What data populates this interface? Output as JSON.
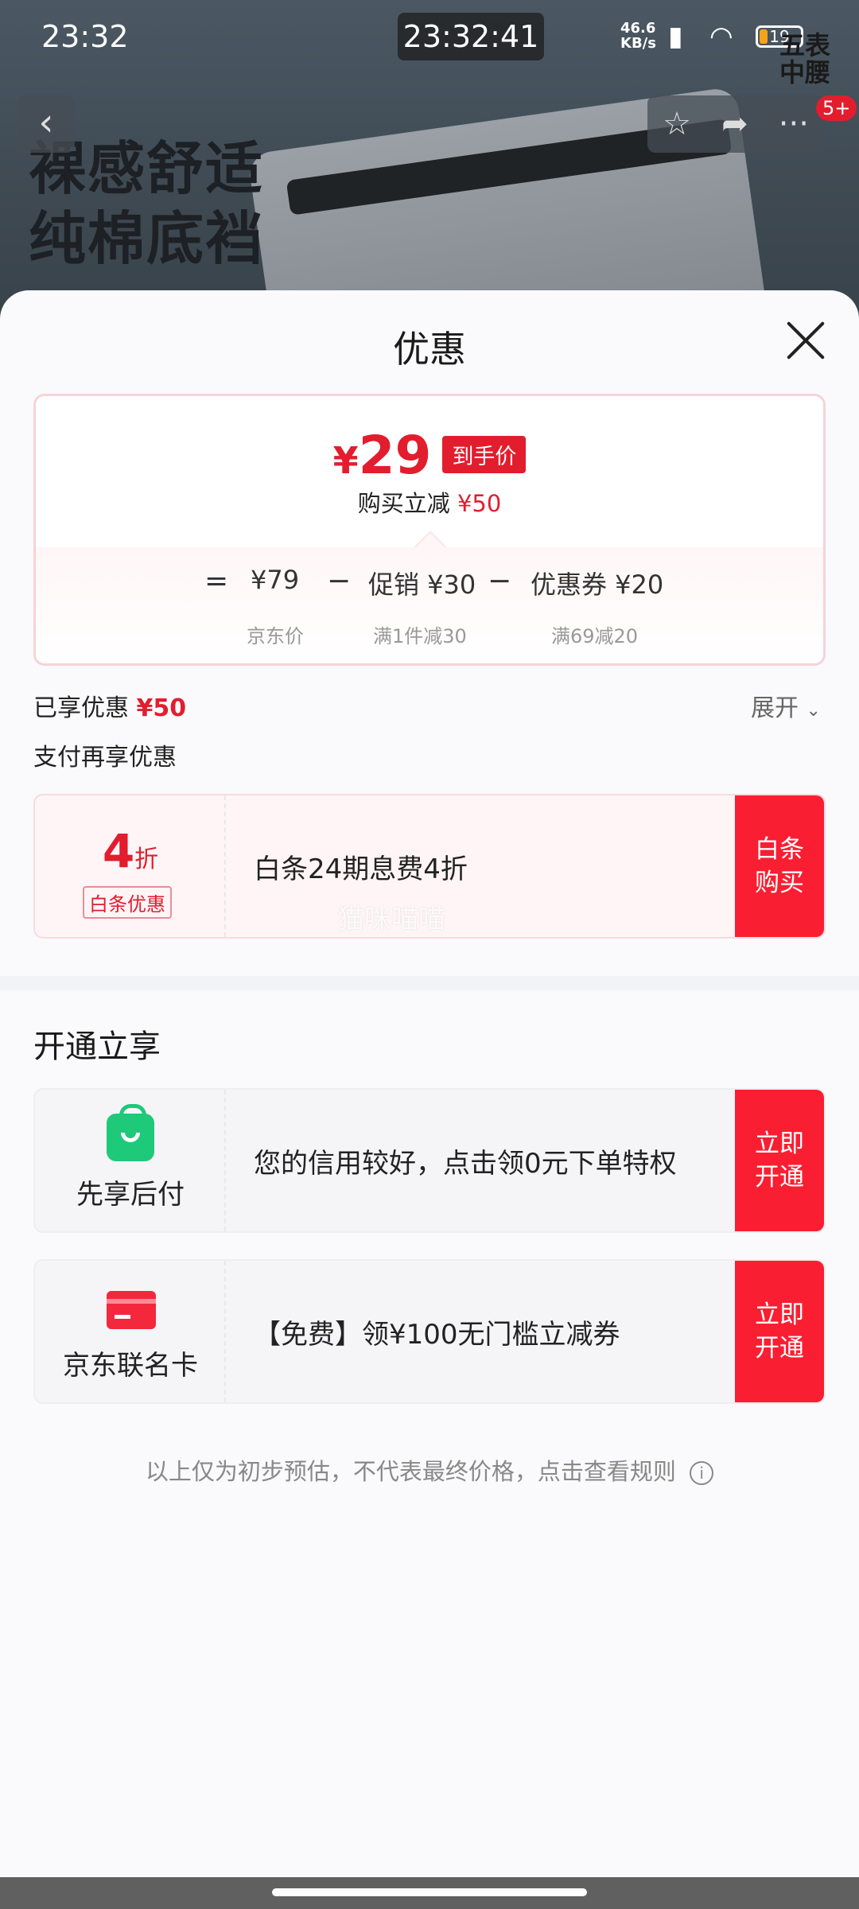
{
  "status_bar": {
    "time": "23:32",
    "clock": "23:32:41",
    "net_speed": "46.6",
    "net_unit": "KB/s",
    "battery": "19",
    "brand_a": "五表",
    "brand_b": "中腰"
  },
  "banner": {
    "slogan_line1": "裸感舒适",
    "slogan_line2": "纯棉底裆",
    "badge": "5+"
  },
  "sheet": {
    "title": "优惠",
    "final_price": {
      "currency": "¥",
      "amount": "29",
      "tag": "到手价"
    },
    "save_text": "购买立减",
    "save_amount": "¥50",
    "breakdown": {
      "equals": "=",
      "jd_price": "¥79",
      "jd_price_label": "京东价",
      "minus": "−",
      "promo": "促销 ¥30",
      "promo_label": "满1件减30",
      "coupon": "优惠券 ¥20",
      "coupon_label": "满69减20"
    },
    "enjoyed_label": "已享优惠",
    "enjoyed_amount": "¥50",
    "expand_label": "展开",
    "pay_more_label": "支付再享优惠",
    "baitiao": {
      "discount_num": "4",
      "discount_unit": "折",
      "tag": "白条优惠",
      "text": "白条24期息费4折",
      "button": "白条购买",
      "watermark": "猫咪喵喵"
    },
    "open_section_title": "开通立享",
    "offers": [
      {
        "icon": "shopping-bag-icon",
        "label": "先享后付",
        "text": "您的信用较好，点击领0元下单特权",
        "button": "立即开通"
      },
      {
        "icon": "bank-card-icon",
        "label": "京东联名卡",
        "text": "【免费】领¥100无门槛立减券",
        "button": "立即开通"
      }
    ],
    "disclaimer": "以上仅为初步预估，不代表最终价格，点击查看规则"
  },
  "colors": {
    "accent_red": "#e21d2e",
    "button_red": "#fa1e32",
    "green_icon": "#1ec97a"
  }
}
